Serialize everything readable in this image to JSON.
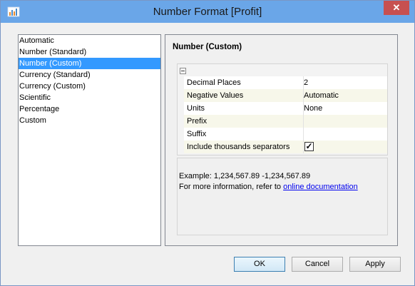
{
  "window": {
    "title": "Number Format [Profit]",
    "close_glyph": "✕"
  },
  "format_list": {
    "items": [
      {
        "label": "Automatic",
        "selected": false
      },
      {
        "label": "Number (Standard)",
        "selected": false
      },
      {
        "label": "Number (Custom)",
        "selected": true
      },
      {
        "label": "Currency (Standard)",
        "selected": false
      },
      {
        "label": "Currency (Custom)",
        "selected": false
      },
      {
        "label": "Scientific",
        "selected": false
      },
      {
        "label": "Percentage",
        "selected": false
      },
      {
        "label": "Custom",
        "selected": false
      }
    ]
  },
  "panel": {
    "title": "Number (Custom)",
    "properties": [
      {
        "name": "Decimal Places",
        "value": "2"
      },
      {
        "name": "Negative Values",
        "value": "Automatic"
      },
      {
        "name": "Units",
        "value": "None"
      },
      {
        "name": "Prefix",
        "value": ""
      },
      {
        "name": "Suffix",
        "value": ""
      },
      {
        "name": "Include thousands separators",
        "value": "",
        "checked": true,
        "check_glyph": "✓"
      }
    ],
    "example_text": "Example: 1,234,567.89  -1,234,567.89",
    "info_text": "For more information, refer to ",
    "info_link": "online documentation"
  },
  "buttons": {
    "ok": "OK",
    "cancel": "Cancel",
    "apply": "Apply"
  },
  "colors": {
    "titlebar": "#6aa6e8",
    "selection": "#3399ff",
    "close": "#c75050"
  }
}
